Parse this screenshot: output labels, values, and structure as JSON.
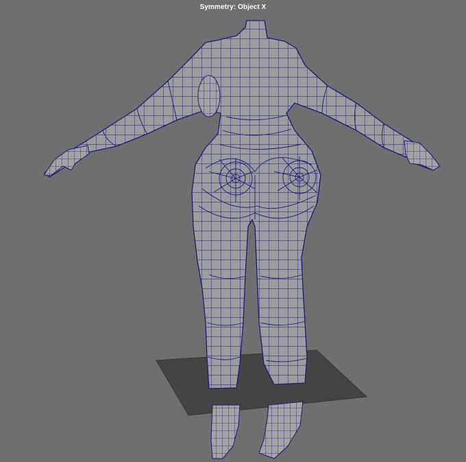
{
  "viewport": {
    "hud_label": "Symmetry: Object X",
    "background_color": "#6f6f6f",
    "mesh_fill_color": "#9c9c9c",
    "mesh_wire_color": "#1a1a7a",
    "ground_plane_color": "#444444"
  }
}
